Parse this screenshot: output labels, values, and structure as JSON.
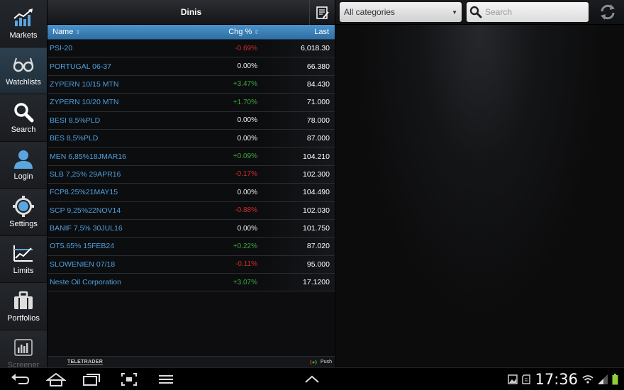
{
  "sidebar": {
    "items": [
      {
        "label": "Markets"
      },
      {
        "label": "Watchlists"
      },
      {
        "label": "Search"
      },
      {
        "label": "Login"
      },
      {
        "label": "Settings"
      },
      {
        "label": "Limits"
      },
      {
        "label": "Portfolios"
      },
      {
        "label": "Screener"
      }
    ]
  },
  "watchlist": {
    "title": "Dinis",
    "columns": {
      "name": "Name",
      "chg": "Chg %",
      "last": "Last"
    },
    "rows": [
      {
        "name": "PSI-20",
        "chg": "-0.69%",
        "last": "6,018.30",
        "dir": "neg"
      },
      {
        "name": "PORTUGAL 06-37",
        "chg": "0.00%",
        "last": "66.380",
        "dir": "zero"
      },
      {
        "name": "ZYPERN 10/15 MTN",
        "chg": "+3.47%",
        "last": "84.430",
        "dir": "pos"
      },
      {
        "name": "ZYPERN 10/20 MTN",
        "chg": "+1.70%",
        "last": "71.000",
        "dir": "pos"
      },
      {
        "name": "BESI 8,5%PLD",
        "chg": "0.00%",
        "last": "78.000",
        "dir": "zero"
      },
      {
        "name": "BES 8,5%PLD",
        "chg": "0.00%",
        "last": "87.000",
        "dir": "zero"
      },
      {
        "name": "MEN 6,85%18JMAR16",
        "chg": "+0.09%",
        "last": "104.210",
        "dir": "pos"
      },
      {
        "name": "SLB 7,25% 29APR16",
        "chg": "-0.17%",
        "last": "102.300",
        "dir": "neg"
      },
      {
        "name": "FCP8.25%21MAY15",
        "chg": "0.00%",
        "last": "104.490",
        "dir": "zero"
      },
      {
        "name": "SCP 9,25%22NOV14",
        "chg": "-0.88%",
        "last": "102.030",
        "dir": "neg"
      },
      {
        "name": "BANIF 7,5% 30JUL16",
        "chg": "0.00%",
        "last": "101.750",
        "dir": "zero"
      },
      {
        "name": "OT5.65% 15FEB24",
        "chg": "+0.22%",
        "last": "87.020",
        "dir": "pos"
      },
      {
        "name": "SLOWENIEN 07/18",
        "chg": "-0.11%",
        "last": "95.000",
        "dir": "neg"
      },
      {
        "name": "Neste Oil Corporation",
        "chg": "+3.07%",
        "last": "17.1200",
        "dir": "pos"
      }
    ],
    "footer": {
      "logo": "TELETRADER",
      "push": "Push"
    }
  },
  "toolbar": {
    "category": "All categories",
    "search_placeholder": "Search"
  },
  "status_bar": {
    "time": "17:36"
  },
  "colors": {
    "accent": "#3a86c2",
    "positive": "#3caa3c",
    "negative": "#d42a2a",
    "link": "#4fa0de"
  }
}
